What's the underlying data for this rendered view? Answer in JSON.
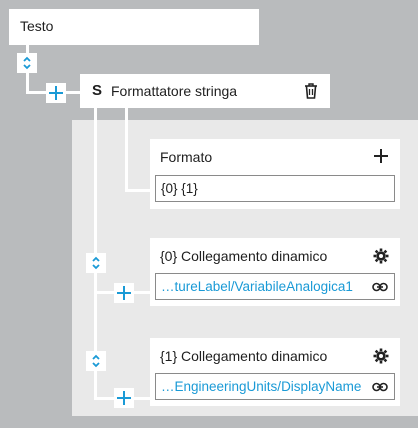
{
  "root_node": {
    "label": "Testo"
  },
  "formatter_node": {
    "badge": "S",
    "label": "Formattatore stringa",
    "delete_icon": "trash-icon"
  },
  "format_node": {
    "label": "Formato",
    "value": "{0} {1}",
    "add_icon": "plus-icon"
  },
  "binding_nodes": [
    {
      "label": "{0} Collegamento dinamico",
      "value": "…tureLabel/VariabileAnalogica1",
      "settings_icon": "gear-icon",
      "link_icon": "link-icon"
    },
    {
      "label": "{1} Collegamento dinamico",
      "value": "…EngineeringUnits/DisplayName",
      "settings_icon": "gear-icon",
      "link_icon": "link-icon"
    }
  ],
  "colors": {
    "background": "#b9bbbd",
    "panel": "#e9e9e9",
    "accent": "#1a9ad6",
    "text": "#1e1e1e"
  }
}
